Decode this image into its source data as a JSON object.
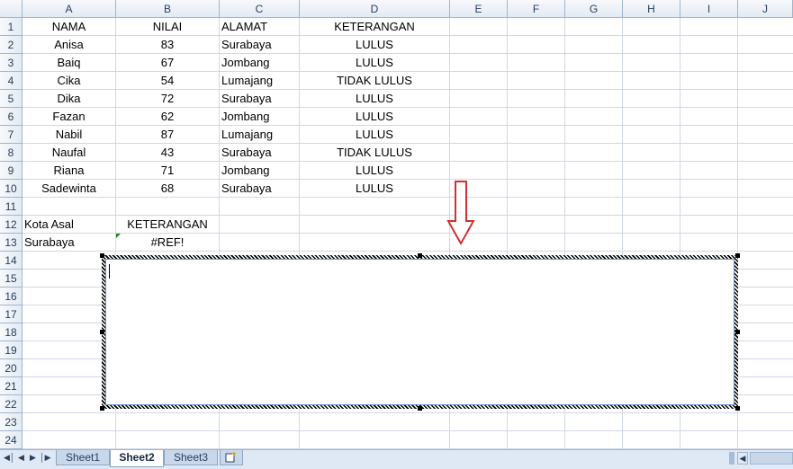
{
  "columns": [
    "A",
    "B",
    "C",
    "D",
    "E",
    "F",
    "G",
    "H",
    "I",
    "J"
  ],
  "rows": [
    "1",
    "2",
    "3",
    "4",
    "5",
    "6",
    "7",
    "8",
    "9",
    "10",
    "11",
    "12",
    "13",
    "14",
    "15",
    "16",
    "17",
    "18",
    "19",
    "20",
    "21",
    "22",
    "23",
    "24"
  ],
  "table": {
    "headers": [
      "NAMA",
      "NILAI",
      "ALAMAT",
      "KETERANGAN"
    ],
    "records": [
      [
        "Anisa",
        "83",
        "Surabaya",
        "LULUS"
      ],
      [
        "Baiq",
        "67",
        "Jombang",
        "LULUS"
      ],
      [
        "Cika",
        "54",
        "Lumajang",
        "TIDAK LULUS"
      ],
      [
        "Dika",
        "72",
        "Surabaya",
        "LULUS"
      ],
      [
        "Fazan",
        "62",
        "Jombang",
        "LULUS"
      ],
      [
        "Nabil",
        "87",
        "Lumajang",
        "LULUS"
      ],
      [
        "Naufal",
        "43",
        "Surabaya",
        "TIDAK LULUS"
      ],
      [
        "Riana",
        "71",
        "Jombang",
        "LULUS"
      ],
      [
        "Sadewinta",
        "68",
        "Surabaya",
        "LULUS"
      ]
    ]
  },
  "lookup": {
    "label_a": "Kota Asal",
    "label_b": "KETERANGAN",
    "value_a": "Surabaya",
    "value_b": "#REF!"
  },
  "sheets": {
    "tab1": "Sheet1",
    "tab2": "Sheet2",
    "tab3": "Sheet3",
    "active": "Sheet2"
  },
  "colors": {
    "header_bg": "#e3eaf3",
    "grid": "#d0d7e5",
    "arrow": "#d03030",
    "error_indicator": "#1a8a1a"
  },
  "icons": {
    "arrow": "down-arrow-annotation",
    "nav": [
      "first-sheet-icon",
      "prev-sheet-icon",
      "next-sheet-icon",
      "last-sheet-icon"
    ],
    "insert": "insert-sheet-icon"
  }
}
